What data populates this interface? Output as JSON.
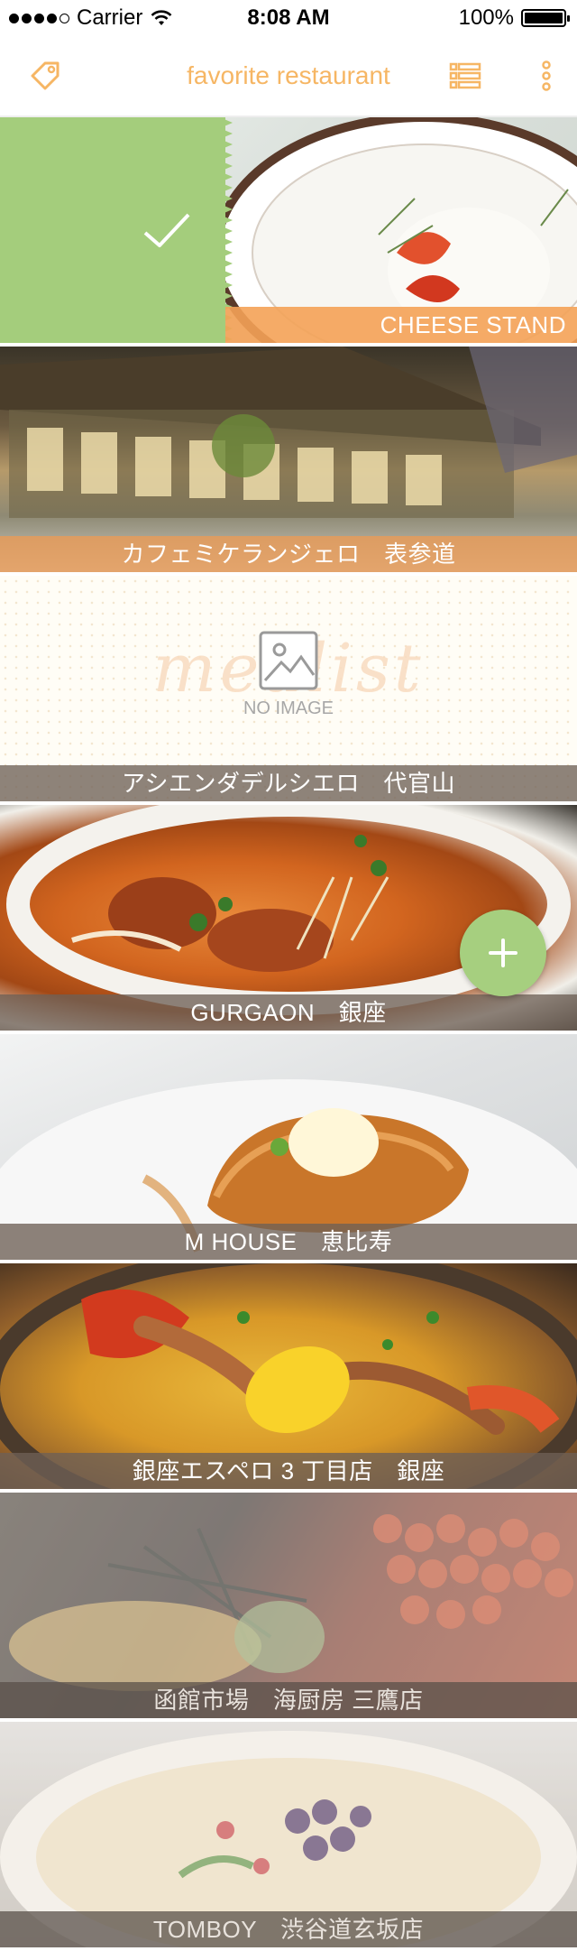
{
  "status_bar": {
    "carrier": "Carrier",
    "time": "8:08 AM",
    "battery": "100%"
  },
  "nav": {
    "title": "favorite restaurant",
    "left_icon": "tag-icon",
    "right_icons": [
      "list-view-icon",
      "more-vertical-icon"
    ]
  },
  "colors": {
    "accent": "#f6b664",
    "swipe_green": "#a4cd7c",
    "label_bar": "#6e6056",
    "orange_bar": "#f4a256"
  },
  "restaurants": [
    {
      "name": "CHEESE STAND",
      "state": "swiped-favorited"
    },
    {
      "name": "カフェミケランジェロ　表参道"
    },
    {
      "name": "アシエンダデルシエロ　代官山",
      "image": "none"
    },
    {
      "name": "GURGAON　銀座"
    },
    {
      "name": "M HOUSE　恵比寿"
    },
    {
      "name": "銀座エスペロ 3 丁目店　銀座"
    },
    {
      "name": "函館市場　海厨房 三鷹店",
      "state": "dimmed"
    },
    {
      "name": "TOMBOY　渋谷道玄坂店",
      "state": "dimmed"
    }
  ],
  "no_image": {
    "watermark": "mealist",
    "text": "NO IMAGE"
  },
  "fab": {
    "icon": "plus-icon"
  }
}
